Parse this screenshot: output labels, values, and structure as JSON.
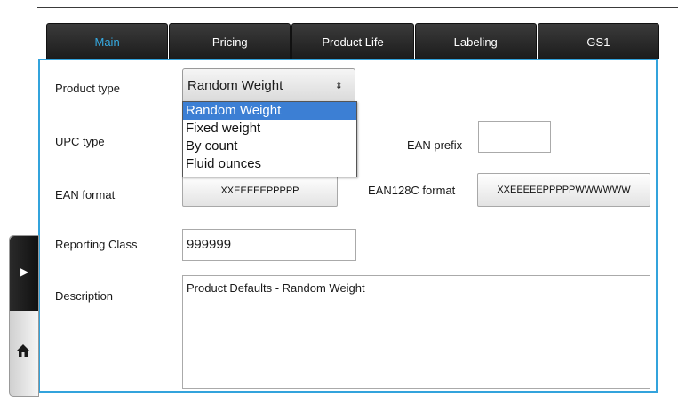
{
  "tabs": [
    {
      "label": "Main",
      "active": true
    },
    {
      "label": "Pricing",
      "active": false
    },
    {
      "label": "Product Life",
      "active": false
    },
    {
      "label": "Labeling",
      "active": false
    },
    {
      "label": "GS1",
      "active": false
    }
  ],
  "form": {
    "product_type_label": "Product type",
    "product_type_value": "Random Weight",
    "product_type_options": [
      "Random Weight",
      "Fixed weight",
      "By count",
      "Fluid ounces"
    ],
    "upc_type_label": "UPC type",
    "ean_prefix_label": "EAN prefix",
    "ean_prefix_value": "",
    "ean_format_label": "EAN format",
    "ean_format_value": "XXEEEEEPPPPP",
    "ean128c_format_label": "EAN128C format",
    "ean128c_format_value": "XXEEEEEPPPPPWWWWWW",
    "reporting_class_label": "Reporting Class",
    "reporting_class_value": "999999",
    "description_label": "Description",
    "description_value": "Product Defaults - Random Weight"
  },
  "icons": {
    "side_expand": "chevron-right-icon",
    "side_home": "home-icon",
    "select_arrow": "updown-arrow-icon"
  },
  "colors": {
    "accent": "#33a3dc",
    "tab_bg": "#2a2a2a",
    "active_tab_text": "#35a9e0",
    "selection": "#3c7fd4"
  }
}
